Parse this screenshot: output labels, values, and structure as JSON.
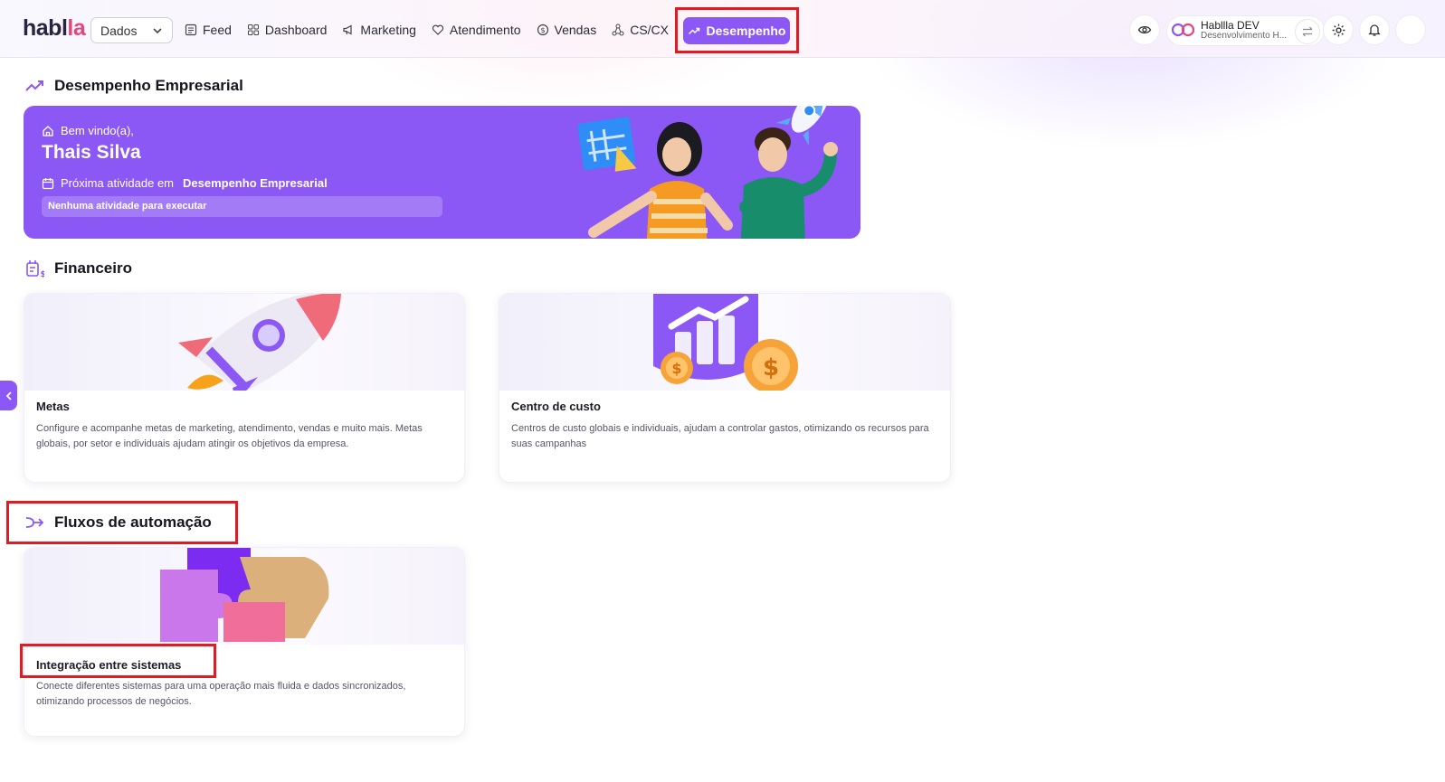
{
  "brand": {
    "logo_main": "habl",
    "logo_accent": "la"
  },
  "header": {
    "select": {
      "value": "Dados"
    },
    "nav": [
      {
        "label": "Feed",
        "icon": "feed-icon"
      },
      {
        "label": "Dashboard",
        "icon": "dashboard-icon"
      },
      {
        "label": "Marketing",
        "icon": "megaphone-icon"
      },
      {
        "label": "Atendimento",
        "icon": "heart-handshake-icon"
      },
      {
        "label": "Vendas",
        "icon": "dollar-circle-icon"
      },
      {
        "label": "CS/CX",
        "icon": "network-icon"
      }
    ],
    "active_nav": {
      "label": "Desempenho",
      "icon": "trending-up-icon"
    },
    "profile": {
      "name": "Habllla DEV",
      "subtitle": "Desenvolvimento H..."
    }
  },
  "sections": {
    "performance": {
      "title": "Desempenho Empresarial",
      "banner": {
        "welcome": "Bem vindo(a),",
        "user_name": "Thais Silva",
        "next_prefix": "Próxima atividade em",
        "next_area": "Desempenho Empresarial",
        "empty_text": "Nenhuma atividade para executar"
      }
    },
    "finance": {
      "title": "Financeiro",
      "cards": [
        {
          "title": "Metas",
          "description": "Configure e acompanhe metas de marketing, atendimento, vendas e muito mais. Metas globais, por setor e individuais ajudam atingir os objetivos da empresa."
        },
        {
          "title": "Centro de custo",
          "description": "Centros de custo globais e individuais, ajudam a controlar gastos, otimizando os recursos para suas campanhas"
        }
      ]
    },
    "automation": {
      "title": "Fluxos de automação",
      "cards": [
        {
          "title": "Integração entre sistemas",
          "description": "Conecte diferentes sistemas para uma operação mais fluida e dados sincronizados, otimizando processos de negócios."
        }
      ]
    }
  },
  "colors": {
    "accent": "#8b57f5",
    "highlight": "#e01b24",
    "logo_accent": "#e2477c"
  }
}
